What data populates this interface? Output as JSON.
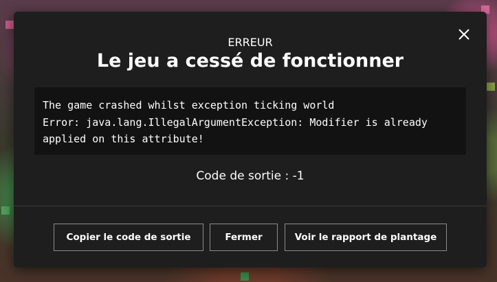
{
  "dialog": {
    "heading": "ERREUR",
    "title": "Le jeu a cessé de fonctionner",
    "error_lines": [
      "The game crashed whilst exception ticking world",
      "Error: java.lang.IllegalArgumentException: Modifier is already",
      "applied on this attribute!"
    ],
    "exit_code": "Code de sortie : -1",
    "buttons": {
      "copy": "Copier le code de sortie",
      "close": "Fermer",
      "report": "Voir le rapport de plantage"
    },
    "close_icon": "close-icon"
  },
  "colors": {
    "dialog_bg": "#1e1e1e",
    "error_box_bg": "#121212",
    "button_border": "#8d8d8d",
    "text": "#ffffff"
  }
}
